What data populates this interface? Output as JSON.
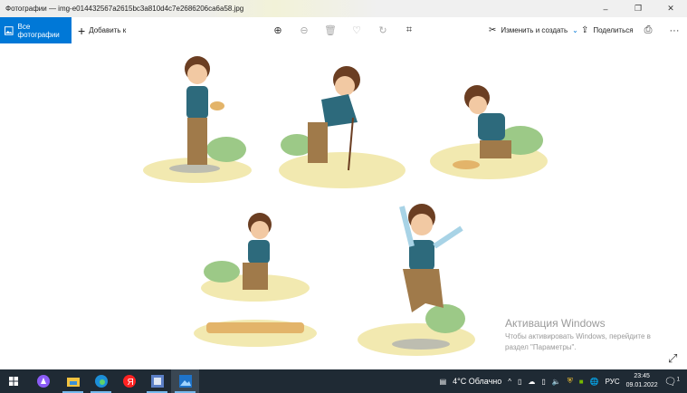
{
  "window": {
    "title": "Фотографии — img-e014432567a2615bc3a810d4c7e2686206ca6a58.jpg",
    "minimize": "–",
    "maximize": "❐",
    "close": "✕"
  },
  "toolbar": {
    "all_photos": "Все фотографии",
    "add_to": "Добавить к",
    "edit_create": "Изменить и создать",
    "share": "Поделиться",
    "more": "···"
  },
  "watermark": {
    "title": "Активация Windows",
    "line1": "Чтобы активировать Windows, перейдите в",
    "line2": "раздел \"Параметры\"."
  },
  "taskbar": {
    "weather": "4°C  Облачно",
    "lang": "РУС",
    "time": "23:45",
    "date": "09.01.2022",
    "notifications": "1"
  },
  "colors": {
    "accent": "#0078d7",
    "taskbar": "#1f2a34"
  }
}
